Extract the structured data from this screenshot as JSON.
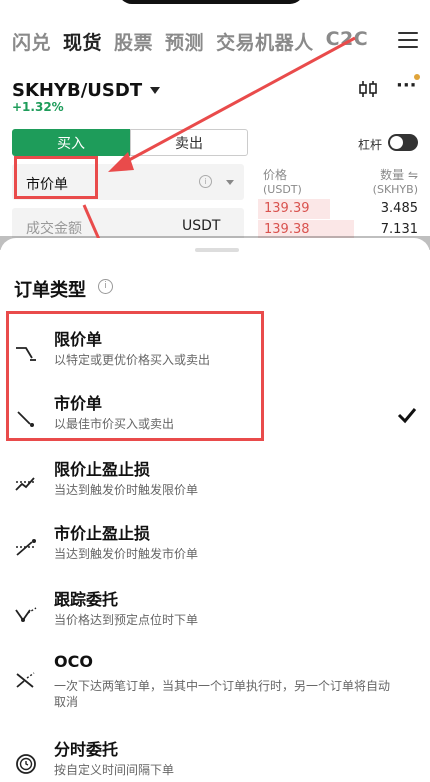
{
  "top_tabs": [
    "闪兑",
    "现货",
    "股票",
    "预测",
    "交易机器人",
    "C2C"
  ],
  "active_tab_index": 1,
  "market": {
    "pair": "SKHYB/USDT",
    "change": "+1.32%"
  },
  "trade": {
    "buy_label": "买入",
    "sell_label": "卖出",
    "leverage_label": "杠杆",
    "order_type_value": "市价单",
    "amount_placeholder": "成交金额",
    "amount_unit": "USDT"
  },
  "orderbook": {
    "price_header": "价格",
    "price_unit": "(USDT)",
    "qty_header": "数量 ⇋",
    "qty_unit": "(SKHYB)",
    "rows": [
      {
        "price": "139.39",
        "qty": "3.485",
        "fill": 0.45
      },
      {
        "price": "139.38",
        "qty": "7.131",
        "fill": 0.6
      }
    ]
  },
  "sheet": {
    "title": "订单类型",
    "options": [
      {
        "name": "限价单",
        "desc": "以特定或更优价格买入或卖出",
        "icon": "limit-order-icon"
      },
      {
        "name": "市价单",
        "desc": "以最佳市价买入或卖出",
        "icon": "market-order-icon",
        "selected": true
      },
      {
        "name": "限价止盈止损",
        "desc": "当达到触发价时触发限价单",
        "icon": "limit-tpsl-icon"
      },
      {
        "name": "市价止盈止损",
        "desc": "当达到触发价时触发市价单",
        "icon": "market-tpsl-icon"
      },
      {
        "name": "跟踪委托",
        "desc": "当价格达到预定点位时下单",
        "icon": "trailing-order-icon"
      },
      {
        "name": "OCO",
        "desc": "一次下达两笔订单，当其中一个订单执行时，另一个订单将自动取消",
        "icon": "oco-icon"
      },
      {
        "name": "分时委托",
        "desc": "按自定义时间间隔下单",
        "icon": "twap-clock-icon"
      }
    ]
  },
  "colors": {
    "accent_green": "#1e9c5a",
    "sell_red": "#d9534f",
    "annotation_red": "#e94b4b"
  }
}
